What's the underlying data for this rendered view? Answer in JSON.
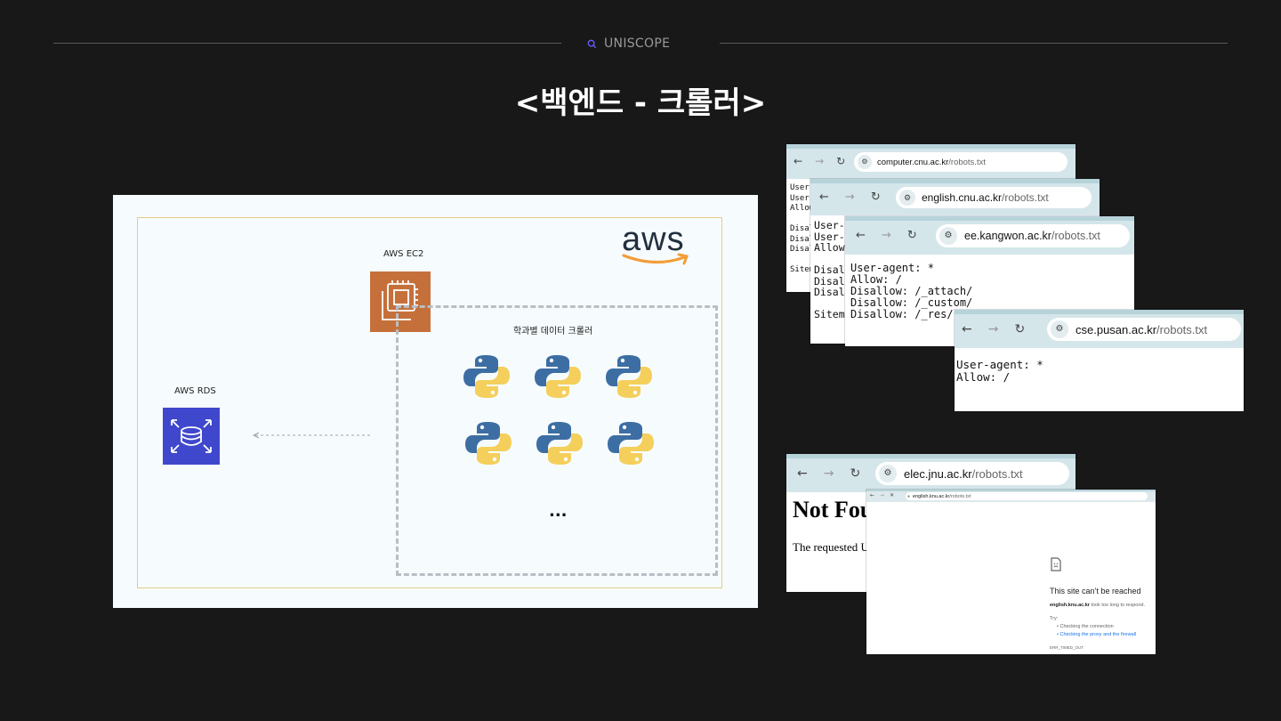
{
  "header": {
    "brand": "UNISCOPE",
    "title": "<백엔드 -  크롤러>"
  },
  "diagram": {
    "aws_logo": "aws",
    "ec2_label": "AWS EC2",
    "rds_label": "AWS RDS",
    "crawler_label": "학과별 데이터 크롤러",
    "ellipsis": "...",
    "python_icons": 6,
    "colors": {
      "ec2": "#c5703b",
      "rds": "#3f48cc",
      "frame": "#e7c98a",
      "python_blue": "#3d6ea3",
      "python_yellow": "#f5cf5b"
    }
  },
  "windows": [
    {
      "host": "computer.cnu.ac.kr",
      "path": "/robots.txt",
      "lines": "User-a\nUser-a\nAllow\n\nDisal\nDisal\nDisal\n\nSitem"
    },
    {
      "host": "english.cnu.ac.kr",
      "path": "/robots.txt",
      "lines": "User-a\nUser-a\nAllow\n\nDisall\nDisall\nDisall\n\nSitema"
    },
    {
      "host": "ee.kangwon.ac.kr",
      "path": "/robots.txt",
      "lines": "User-agent: *\nAllow: /\nDisallow: /_attach/\nDisallow: /_custom/\nDisallow: /_res/"
    },
    {
      "host": "cse.pusan.ac.kr",
      "path": "/robots.txt",
      "lines": "User-agent: *\nAllow: /"
    },
    {
      "host": "elec.jnu.ac.kr",
      "path": "/robots.txt",
      "nf_title": "Not Fou",
      "nf_body": "The requested U"
    },
    {
      "host": "english.knu.ac.kr",
      "path": "/robots.txt",
      "error_title": "This site can’t be reached",
      "error_host": "english.knu.ac.kr",
      "error_msg": " took too long to respond.",
      "try_label": "Try:",
      "suggestions": [
        "Checking the connection",
        "Checking the proxy and the firewall"
      ],
      "error_code": "ERR_TIMED_OUT"
    }
  ]
}
